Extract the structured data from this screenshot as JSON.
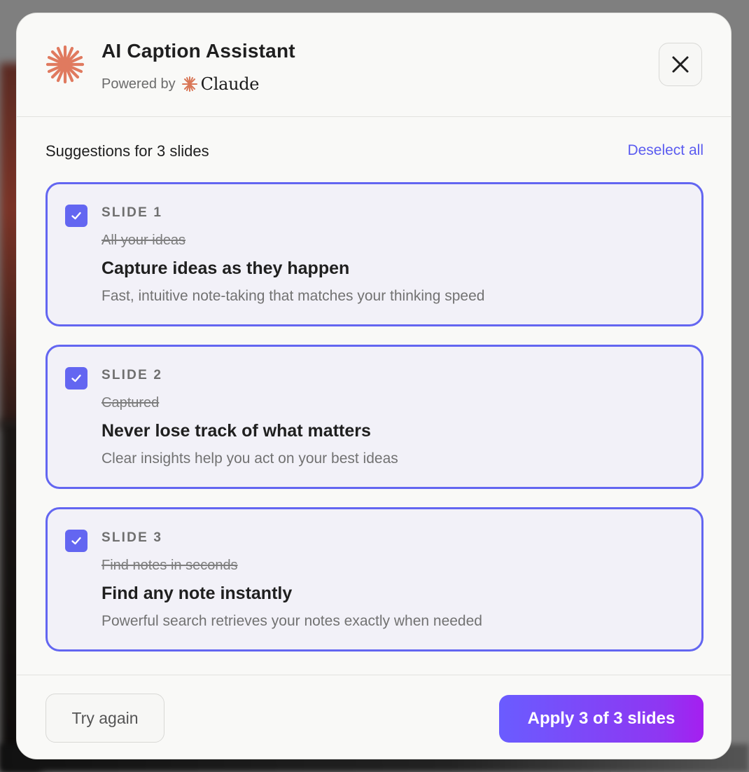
{
  "colors": {
    "accent": "#6366f1",
    "link": "#5b5cf0",
    "brand_orange": "#e07a5f",
    "card_bg": "#f2f1f8",
    "apply_gradient_start": "#6a5cff",
    "apply_gradient_end": "#a51ff0"
  },
  "header": {
    "title": "AI Caption Assistant",
    "powered_by_label": "Powered by",
    "brand_name": "Claude",
    "logo_icon": "sparkle-burst-icon",
    "close_icon": "close-icon"
  },
  "toolbar": {
    "suggestions_label": "Suggestions for 3 slides",
    "deselect_label": "Deselect all"
  },
  "cards": [
    {
      "slide_label": "SLIDE 1",
      "old_caption": "All your ideas",
      "new_caption": "Capture ideas as they happen",
      "subtitle": "Fast, intuitive note-taking that matches your thinking speed",
      "checked": true
    },
    {
      "slide_label": "SLIDE 2",
      "old_caption": "Captured",
      "new_caption": "Never lose track of what matters",
      "subtitle": "Clear insights help you act on your best ideas",
      "checked": true
    },
    {
      "slide_label": "SLIDE 3",
      "old_caption": "Find notes in seconds",
      "new_caption": "Find any note instantly",
      "subtitle": "Powerful search retrieves your notes exactly when needed",
      "checked": true
    }
  ],
  "footer": {
    "try_again_label": "Try again",
    "apply_label": "Apply 3 of 3 slides"
  }
}
